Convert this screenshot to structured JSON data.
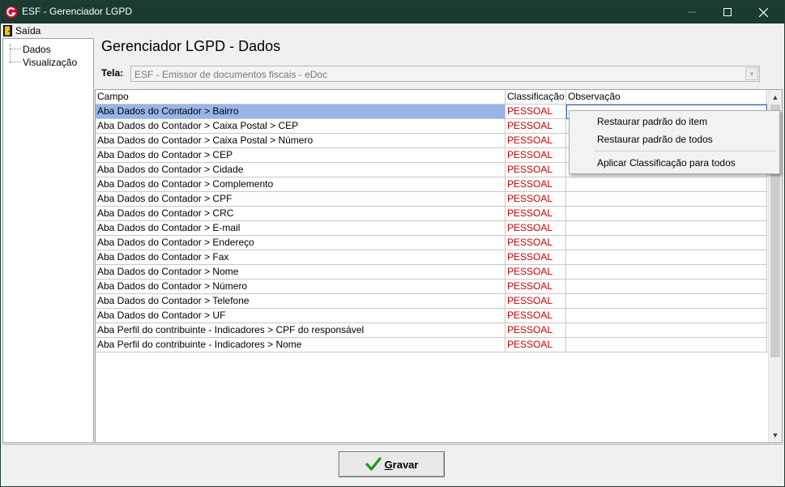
{
  "window": {
    "title": "ESF - Gerenciador LGPD",
    "app_icon": "esf-logo-icon"
  },
  "menu": {
    "saida_label": "Saída",
    "saida_icon": "door-exit-icon"
  },
  "tree": {
    "items": [
      {
        "label": "Dados"
      },
      {
        "label": "Visualização"
      }
    ]
  },
  "page": {
    "title": "Gerenciador LGPD - Dados"
  },
  "tela": {
    "label": "Tela:",
    "value": "ESF - Emissor de documentos fiscais - eDoc"
  },
  "grid": {
    "columns": [
      "Campo",
      "Classificação",
      "Observação"
    ],
    "rows": [
      {
        "campo": "Aba Dados do Contador > Bairro",
        "classificacao": "PESSOAL",
        "observacao": ""
      },
      {
        "campo": "Aba Dados do Contador > Caixa Postal > CEP",
        "classificacao": "PESSOAL",
        "observacao": ""
      },
      {
        "campo": "Aba Dados do Contador > Caixa Postal > Número",
        "classificacao": "PESSOAL",
        "observacao": ""
      },
      {
        "campo": "Aba Dados do Contador > CEP",
        "classificacao": "PESSOAL",
        "observacao": ""
      },
      {
        "campo": "Aba Dados do Contador > Cidade",
        "classificacao": "PESSOAL",
        "observacao": ""
      },
      {
        "campo": "Aba Dados do Contador > Complemento",
        "classificacao": "PESSOAL",
        "observacao": ""
      },
      {
        "campo": "Aba Dados do Contador > CPF",
        "classificacao": "PESSOAL",
        "observacao": ""
      },
      {
        "campo": "Aba Dados do Contador > CRC",
        "classificacao": "PESSOAL",
        "observacao": ""
      },
      {
        "campo": "Aba Dados do Contador > E-mail",
        "classificacao": "PESSOAL",
        "observacao": ""
      },
      {
        "campo": "Aba Dados do Contador > Endereço",
        "classificacao": "PESSOAL",
        "observacao": ""
      },
      {
        "campo": "Aba Dados do Contador > Fax",
        "classificacao": "PESSOAL",
        "observacao": ""
      },
      {
        "campo": "Aba Dados do Contador > Nome",
        "classificacao": "PESSOAL",
        "observacao": ""
      },
      {
        "campo": "Aba Dados do Contador > Número",
        "classificacao": "PESSOAL",
        "observacao": ""
      },
      {
        "campo": "Aba Dados do Contador > Telefone",
        "classificacao": "PESSOAL",
        "observacao": ""
      },
      {
        "campo": "Aba Dados do Contador > UF",
        "classificacao": "PESSOAL",
        "observacao": ""
      },
      {
        "campo": "Aba Perfil do contribuinte - Indicadores > CPF do responsável",
        "classificacao": "PESSOAL",
        "observacao": ""
      },
      {
        "campo": "Aba Perfil do contribuinte - Indicadores > Nome",
        "classificacao": "PESSOAL",
        "observacao": ""
      }
    ],
    "selected_row": 0
  },
  "context_menu": {
    "items": [
      "Restaurar padrão do item",
      "Restaurar padrão de todos",
      "Aplicar Classificação para todos"
    ]
  },
  "footer": {
    "gravar_prefix": "G",
    "gravar_rest": "ravar",
    "gravar_icon": "checkmark-icon"
  },
  "colors": {
    "titlebar": "#1b3a30",
    "classification": "#cc0000",
    "selection": "#99b4e8",
    "checkmark": "#1a9a1a"
  }
}
